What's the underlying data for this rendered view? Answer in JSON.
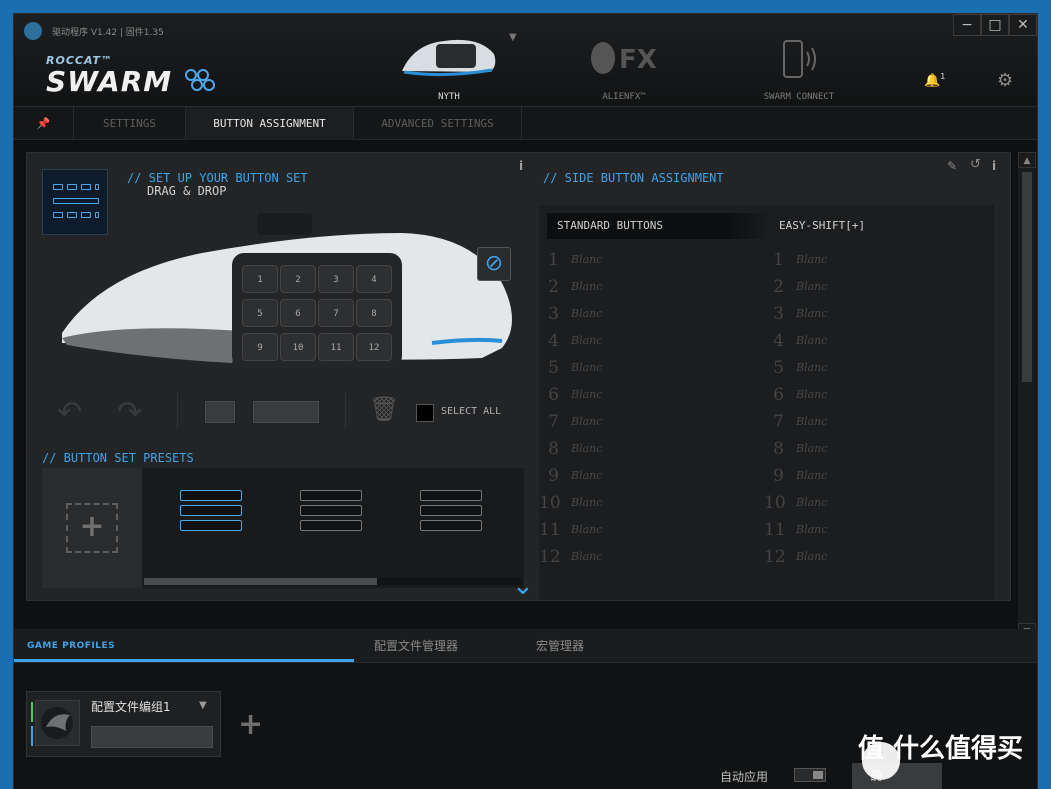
{
  "app": {
    "title": "驱动程序 V1.42 | 固件1.35",
    "logo_top": "ROCCAT™",
    "logo_main": "SWARM"
  },
  "devices": [
    {
      "label": "NYTH",
      "active": true
    },
    {
      "label": "ALIENFX™",
      "active": false
    },
    {
      "label": "SWARM CONNECT",
      "active": false
    }
  ],
  "notifications": {
    "count": "1"
  },
  "tabs": [
    {
      "label": "SETTINGS"
    },
    {
      "label": "BUTTON ASSIGNMENT"
    },
    {
      "label": "ADVANCED SETTINGS"
    }
  ],
  "left": {
    "header": "// SET UP YOUR BUTTON SET",
    "sub": "DRAG & DROP",
    "select_all": "SELECT ALL",
    "presets_header": "// BUTTON SET PRESETS",
    "mouse_buttons": [
      "1",
      "2",
      "3",
      "4",
      "5",
      "6",
      "7",
      "8",
      "9",
      "10",
      "11",
      "12"
    ]
  },
  "side": {
    "header": "// SIDE BUTTON ASSIGNMENT",
    "col_standard": "STANDARD BUTTONS",
    "col_easyshift": "EASY-SHIFT[+]",
    "rows": [
      {
        "n": "1",
        "std": "Blanc",
        "es": "Blanc"
      },
      {
        "n": "2",
        "std": "Blanc",
        "es": "Blanc"
      },
      {
        "n": "3",
        "std": "Blanc",
        "es": "Blanc"
      },
      {
        "n": "4",
        "std": "Blanc",
        "es": "Blanc"
      },
      {
        "n": "5",
        "std": "Blanc",
        "es": "Blanc"
      },
      {
        "n": "6",
        "std": "Blanc",
        "es": "Blanc"
      },
      {
        "n": "7",
        "std": "Blanc",
        "es": "Blanc"
      },
      {
        "n": "8",
        "std": "Blanc",
        "es": "Blanc"
      },
      {
        "n": "9",
        "std": "Blanc",
        "es": "Blanc"
      },
      {
        "n": "10",
        "std": "Blanc",
        "es": "Blanc"
      },
      {
        "n": "11",
        "std": "Blanc",
        "es": "Blanc"
      },
      {
        "n": "12",
        "std": "Blanc",
        "es": "Blanc"
      }
    ]
  },
  "bottom": {
    "tabs": [
      {
        "label": "GAME PROFILES"
      },
      {
        "label": "配置文件管理器"
      },
      {
        "label": "宏管理器"
      }
    ],
    "profile_name": "配置文件编组1",
    "auto_apply": "自动应用",
    "ok": "确"
  },
  "watermark": "值 什么值得买",
  "colors": {
    "accent": "#3ea3e8",
    "bg": "#0f1011",
    "panel": "#232426"
  }
}
